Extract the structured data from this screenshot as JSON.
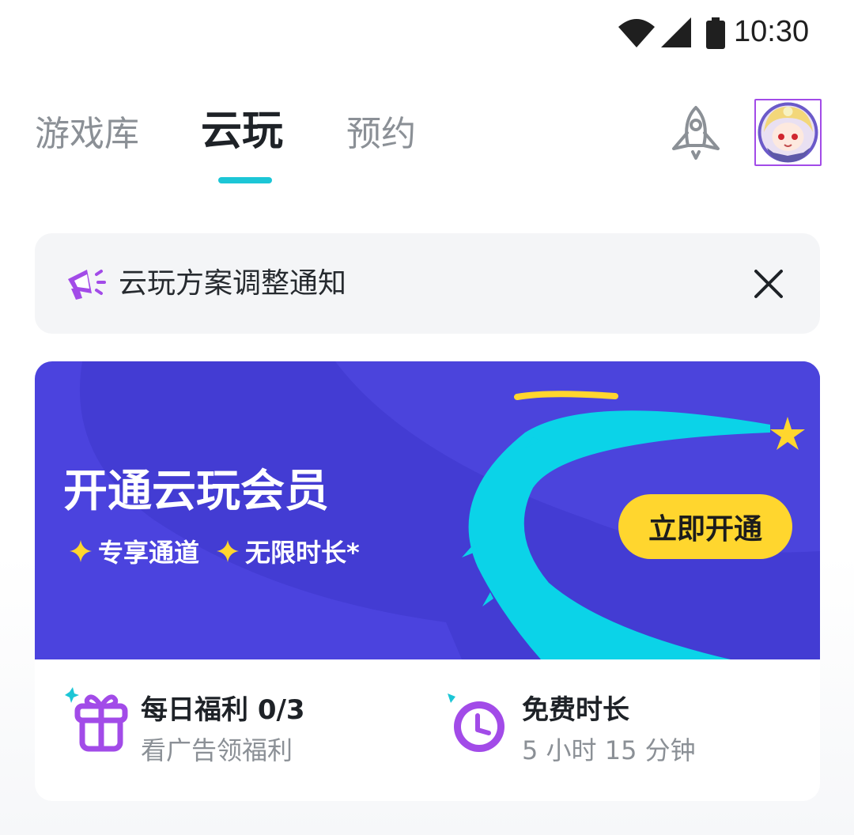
{
  "status_bar": {
    "time": "10:30"
  },
  "tabs": [
    {
      "label": "游戏库",
      "active": false
    },
    {
      "label": "云玩",
      "active": true
    },
    {
      "label": "预约",
      "active": false
    }
  ],
  "notice": {
    "text": "云玩方案调整通知"
  },
  "promo": {
    "title": "开通云玩会员",
    "features": [
      "专享通道",
      "无限时长*"
    ],
    "button_label": "立即开通"
  },
  "perks": {
    "daily": {
      "title": "每日福利 0/3",
      "subtitle": "看广告领福利"
    },
    "free_time": {
      "title": "免费时长",
      "subtitle": "5 小时 15 分钟"
    }
  },
  "colors": {
    "accent_teal": "#1cc6d6",
    "banner_purple": "#4b43de",
    "button_yellow": "#ffd62e",
    "icon_purple": "#a24be8"
  }
}
